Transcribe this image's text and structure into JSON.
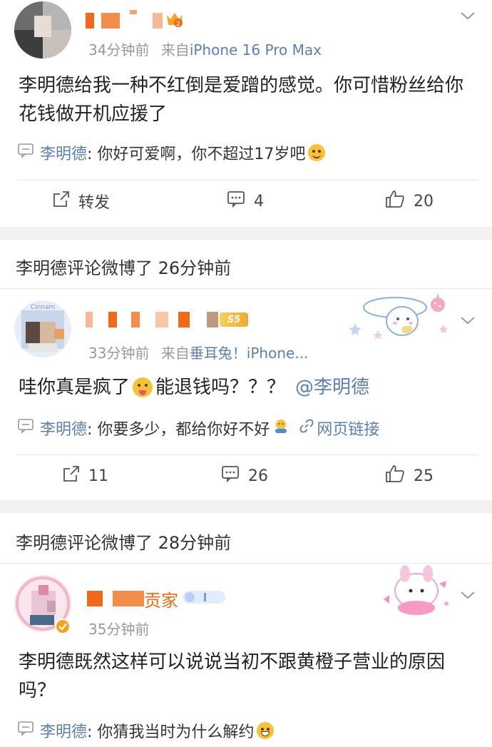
{
  "comments": [
    {
      "meta_time": "34分钟前",
      "meta_source": "来自",
      "meta_device": "iPhone 16 Pro Max",
      "content": "李明德给我一种不红倒是爱蹭的感觉。你可惜粉丝给你花钱做开机应援了",
      "reply_name": "李明德",
      "reply_text": ": 你好可爱啊，你不超过17岁吧",
      "repost_label": "转发",
      "comment_count": "4",
      "like_count": "20"
    },
    {
      "meta_time": "33分钟前",
      "meta_source": "来自",
      "meta_device": "垂耳兔！iPhone...",
      "content_prefix": "哇你真是疯了",
      "content_suffix": "能退钱吗？？？",
      "mention": "@李明德",
      "reply_name": "李明德",
      "reply_text": ": 你要多少，都给你好不好",
      "reply_link": "网页链接",
      "repost_count": "11",
      "comment_count": "26",
      "like_count": "25",
      "badge": "S5"
    },
    {
      "name_partial": "贡家",
      "meta_time": "35分钟前",
      "content": "李明德既然这样可以说说当初不跟黄橙子营业的原因吗？",
      "reply_name": "李明德",
      "reply_text": ": 你猜我当时为什么解约"
    }
  ],
  "notices": [
    "李明德评论微博了 26分钟前",
    "李明德评论微博了 28分钟前"
  ],
  "colors": {
    "link": "#5b7fb3",
    "separator": "#f2f2f2",
    "emoji": "#f7c23a"
  }
}
